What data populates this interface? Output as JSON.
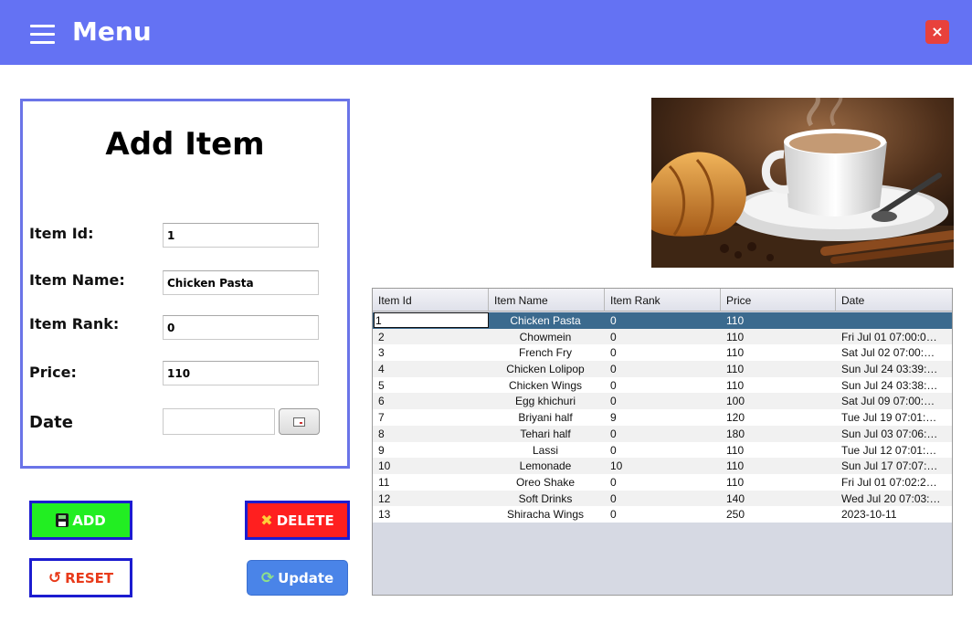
{
  "header": {
    "title": "Menu",
    "close_label": "×",
    "background": "#6472f3"
  },
  "form": {
    "title": "Add Item",
    "fields": [
      {
        "label": "Item Id:",
        "value": "1"
      },
      {
        "label": "Item Name:",
        "value": "Chicken Pasta"
      },
      {
        "label": "Item Rank:",
        "value": "0"
      },
      {
        "label": "Price:",
        "value": "110"
      },
      {
        "label": "Date",
        "value": ""
      }
    ]
  },
  "buttons": {
    "add": "ADD",
    "delete": "DELETE",
    "reset": "RESET",
    "update": "Update"
  },
  "table": {
    "columns": [
      "Item Id",
      "Item Name",
      "Item Rank",
      "Price",
      "Date"
    ],
    "rows": [
      [
        "1",
        "Chicken Pasta",
        "0",
        "110",
        ""
      ],
      [
        "2",
        "Chowmein",
        "0",
        "110",
        "Fri Jul 01 07:00:0…"
      ],
      [
        "3",
        "French Fry",
        "0",
        "110",
        "Sat Jul 02 07:00:…"
      ],
      [
        "4",
        "Chicken Lolipop",
        "0",
        "110",
        "Sun Jul 24 03:39:…"
      ],
      [
        "5",
        "Chicken Wings",
        "0",
        "110",
        "Sun Jul 24 03:38:…"
      ],
      [
        "6",
        "Egg khichuri",
        "0",
        "100",
        "Sat Jul 09 07:00:…"
      ],
      [
        "7",
        "Briyani half",
        "9",
        "120",
        "Tue Jul 19 07:01:…"
      ],
      [
        "8",
        "Tehari half",
        "0",
        "180",
        "Sun Jul 03 07:06:…"
      ],
      [
        "9",
        "Lassi",
        "0",
        "110",
        "Tue Jul 12 07:01:…"
      ],
      [
        "10",
        "Lemonade",
        "10",
        "110",
        "Sun Jul 17 07:07:…"
      ],
      [
        "11",
        "Oreo Shake",
        "0",
        "110",
        "Fri Jul 01 07:02:2…"
      ],
      [
        "12",
        "Soft Drinks",
        "0",
        "140",
        "Wed Jul 20 07:03:…"
      ],
      [
        "13",
        "Shiracha Wings",
        "0",
        "250",
        "2023-10-11"
      ]
    ],
    "selected_row": 0
  },
  "colors": {
    "accent": "#6472f3",
    "add": "#22ee22",
    "delete": "#ff1f1f",
    "update": "#4a84e8",
    "selected_row": "#3b6a8e"
  }
}
